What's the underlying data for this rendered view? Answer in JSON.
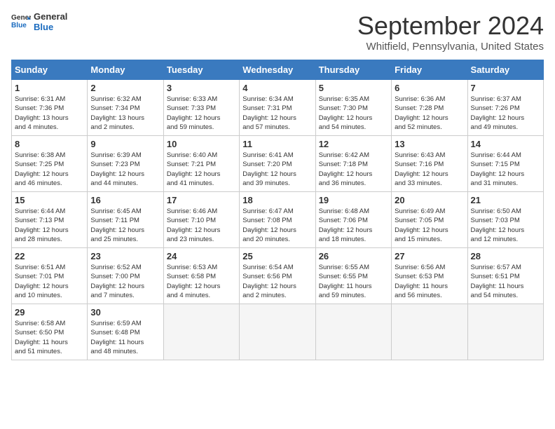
{
  "header": {
    "logo_line1": "General",
    "logo_line2": "Blue",
    "month": "September 2024",
    "location": "Whitfield, Pennsylvania, United States"
  },
  "weekdays": [
    "Sunday",
    "Monday",
    "Tuesday",
    "Wednesday",
    "Thursday",
    "Friday",
    "Saturday"
  ],
  "weeks": [
    [
      {
        "day": "1",
        "info": "Sunrise: 6:31 AM\nSunset: 7:36 PM\nDaylight: 13 hours\nand 4 minutes."
      },
      {
        "day": "2",
        "info": "Sunrise: 6:32 AM\nSunset: 7:34 PM\nDaylight: 13 hours\nand 2 minutes."
      },
      {
        "day": "3",
        "info": "Sunrise: 6:33 AM\nSunset: 7:33 PM\nDaylight: 12 hours\nand 59 minutes."
      },
      {
        "day": "4",
        "info": "Sunrise: 6:34 AM\nSunset: 7:31 PM\nDaylight: 12 hours\nand 57 minutes."
      },
      {
        "day": "5",
        "info": "Sunrise: 6:35 AM\nSunset: 7:30 PM\nDaylight: 12 hours\nand 54 minutes."
      },
      {
        "day": "6",
        "info": "Sunrise: 6:36 AM\nSunset: 7:28 PM\nDaylight: 12 hours\nand 52 minutes."
      },
      {
        "day": "7",
        "info": "Sunrise: 6:37 AM\nSunset: 7:26 PM\nDaylight: 12 hours\nand 49 minutes."
      }
    ],
    [
      {
        "day": "8",
        "info": "Sunrise: 6:38 AM\nSunset: 7:25 PM\nDaylight: 12 hours\nand 46 minutes."
      },
      {
        "day": "9",
        "info": "Sunrise: 6:39 AM\nSunset: 7:23 PM\nDaylight: 12 hours\nand 44 minutes."
      },
      {
        "day": "10",
        "info": "Sunrise: 6:40 AM\nSunset: 7:21 PM\nDaylight: 12 hours\nand 41 minutes."
      },
      {
        "day": "11",
        "info": "Sunrise: 6:41 AM\nSunset: 7:20 PM\nDaylight: 12 hours\nand 39 minutes."
      },
      {
        "day": "12",
        "info": "Sunrise: 6:42 AM\nSunset: 7:18 PM\nDaylight: 12 hours\nand 36 minutes."
      },
      {
        "day": "13",
        "info": "Sunrise: 6:43 AM\nSunset: 7:16 PM\nDaylight: 12 hours\nand 33 minutes."
      },
      {
        "day": "14",
        "info": "Sunrise: 6:44 AM\nSunset: 7:15 PM\nDaylight: 12 hours\nand 31 minutes."
      }
    ],
    [
      {
        "day": "15",
        "info": "Sunrise: 6:44 AM\nSunset: 7:13 PM\nDaylight: 12 hours\nand 28 minutes."
      },
      {
        "day": "16",
        "info": "Sunrise: 6:45 AM\nSunset: 7:11 PM\nDaylight: 12 hours\nand 25 minutes."
      },
      {
        "day": "17",
        "info": "Sunrise: 6:46 AM\nSunset: 7:10 PM\nDaylight: 12 hours\nand 23 minutes."
      },
      {
        "day": "18",
        "info": "Sunrise: 6:47 AM\nSunset: 7:08 PM\nDaylight: 12 hours\nand 20 minutes."
      },
      {
        "day": "19",
        "info": "Sunrise: 6:48 AM\nSunset: 7:06 PM\nDaylight: 12 hours\nand 18 minutes."
      },
      {
        "day": "20",
        "info": "Sunrise: 6:49 AM\nSunset: 7:05 PM\nDaylight: 12 hours\nand 15 minutes."
      },
      {
        "day": "21",
        "info": "Sunrise: 6:50 AM\nSunset: 7:03 PM\nDaylight: 12 hours\nand 12 minutes."
      }
    ],
    [
      {
        "day": "22",
        "info": "Sunrise: 6:51 AM\nSunset: 7:01 PM\nDaylight: 12 hours\nand 10 minutes."
      },
      {
        "day": "23",
        "info": "Sunrise: 6:52 AM\nSunset: 7:00 PM\nDaylight: 12 hours\nand 7 minutes."
      },
      {
        "day": "24",
        "info": "Sunrise: 6:53 AM\nSunset: 6:58 PM\nDaylight: 12 hours\nand 4 minutes."
      },
      {
        "day": "25",
        "info": "Sunrise: 6:54 AM\nSunset: 6:56 PM\nDaylight: 12 hours\nand 2 minutes."
      },
      {
        "day": "26",
        "info": "Sunrise: 6:55 AM\nSunset: 6:55 PM\nDaylight: 11 hours\nand 59 minutes."
      },
      {
        "day": "27",
        "info": "Sunrise: 6:56 AM\nSunset: 6:53 PM\nDaylight: 11 hours\nand 56 minutes."
      },
      {
        "day": "28",
        "info": "Sunrise: 6:57 AM\nSunset: 6:51 PM\nDaylight: 11 hours\nand 54 minutes."
      }
    ],
    [
      {
        "day": "29",
        "info": "Sunrise: 6:58 AM\nSunset: 6:50 PM\nDaylight: 11 hours\nand 51 minutes."
      },
      {
        "day": "30",
        "info": "Sunrise: 6:59 AM\nSunset: 6:48 PM\nDaylight: 11 hours\nand 48 minutes."
      },
      {
        "day": "",
        "info": ""
      },
      {
        "day": "",
        "info": ""
      },
      {
        "day": "",
        "info": ""
      },
      {
        "day": "",
        "info": ""
      },
      {
        "day": "",
        "info": ""
      }
    ]
  ]
}
